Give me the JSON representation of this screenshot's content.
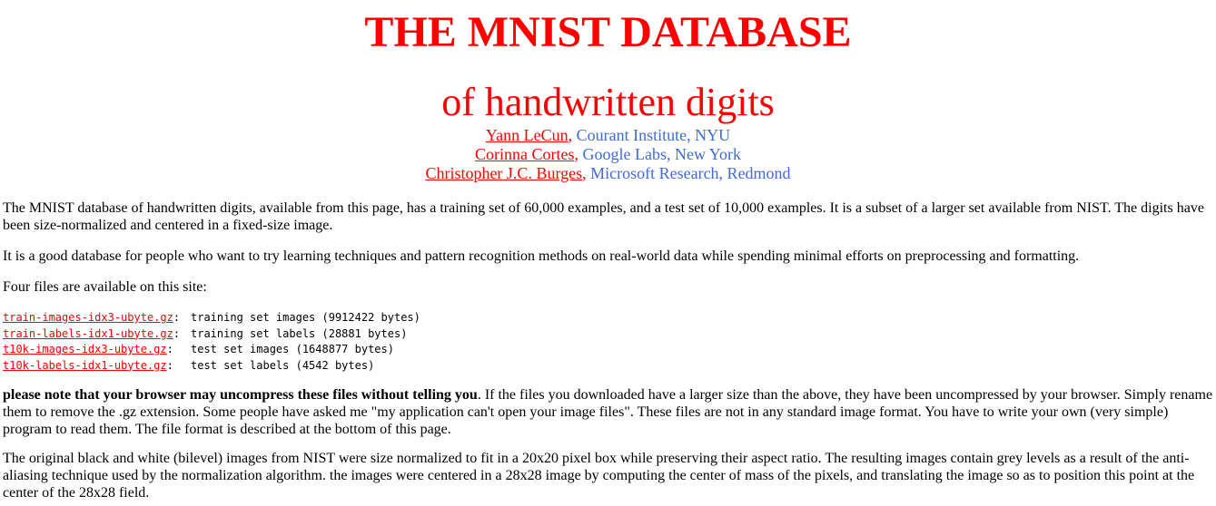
{
  "header": {
    "title": "THE MNIST DATABASE",
    "subtitle": "of handwritten digits"
  },
  "authors": [
    {
      "name": "Yann LeCun",
      "affiliation": "Courant Institute, NYU"
    },
    {
      "name": "Corinna Cortes",
      "affiliation": "Google Labs, New York"
    },
    {
      "name": "Christopher J.C. Burges",
      "affiliation": "Microsoft Research, Redmond"
    }
  ],
  "paragraphs": {
    "intro": "The MNIST database of handwritten digits, available from this page, has a training set of 60,000 examples, and a test set of 10,000 examples. It is a subset of a larger set available from NIST. The digits have been size-normalized and centered in a fixed-size image.",
    "good_db": "It is a good database for people who want to try learning techniques and pattern recognition methods on real-world data while spending minimal efforts on preprocessing and formatting.",
    "four_files": "Four files are available on this site:",
    "note_bold": "please note that your browser may uncompress these files without telling you",
    "note_rest": ". If the files you downloaded have a larger size than the above, they have been uncompressed by your browser. Simply rename them to remove the .gz extension. Some people have asked me \"my application can't open your image files\". These files are not in any standard image format. You have to write your own (very simple) program to read them. The file format is described at the bottom of this page.",
    "original": "The original black and white (bilevel) images from NIST were size normalized to fit in a 20x20 pixel box while preserving their aspect ratio. The resulting images contain grey levels as a result of the anti-aliasing technique used by the normalization algorithm. the images were centered in a 28x28 image by computing the center of mass of the pixels, and translating the image so as to position this point at the center of the 28x28 field."
  },
  "files": [
    {
      "name": "train-images-idx3-ubyte.gz",
      "desc": "training set images (9912422 bytes)"
    },
    {
      "name": "train-labels-idx1-ubyte.gz",
      "desc": "training set labels (28881 bytes)"
    },
    {
      "name": "t10k-images-idx3-ubyte.gz",
      "desc": "test set images (1648877 bytes)"
    },
    {
      "name": "t10k-labels-idx1-ubyte.gz",
      "desc": "test set labels (4542 bytes)"
    }
  ],
  "colors": {
    "title": "#ff0000",
    "link": "#ff0000",
    "affiliation": "#4169e1"
  }
}
